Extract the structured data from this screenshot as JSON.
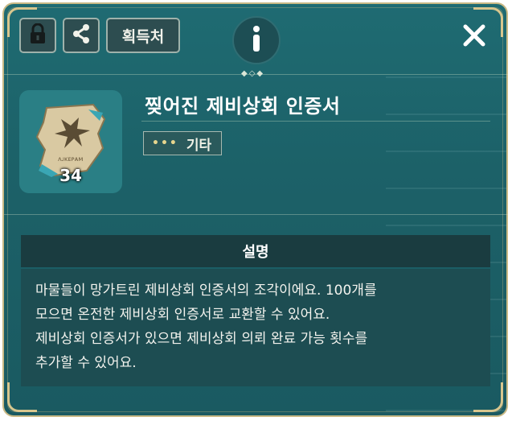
{
  "toolbar": {
    "lock_icon": "lock-icon",
    "share_icon": "share-icon",
    "source_label": "획득처",
    "info_icon": "info-icon",
    "close_icon": "close-icon"
  },
  "item": {
    "name": "찢어진 제비상회 인증서",
    "count": "34",
    "category_icon": "dots-icon",
    "category": "기타",
    "icon": "torn-certificate-icon"
  },
  "description": {
    "header": "설명",
    "lines": [
      "마물들이 망가트린 제비상회 인증서의 조각이에요. 100개를",
      "모으면 온전한 제비상회 인증서로 교환할 수 있어요.",
      "제비상회 인증서가 있으면 제비상회 의뢰 완료 가능 횟수를",
      "추가할 수 있어요."
    ]
  },
  "colors": {
    "panel_bg": "#1d6369",
    "frame_gold": "#c9b985",
    "desc_header_bg": "#1a3c40",
    "desc_body_bg": "#1d4d52"
  }
}
